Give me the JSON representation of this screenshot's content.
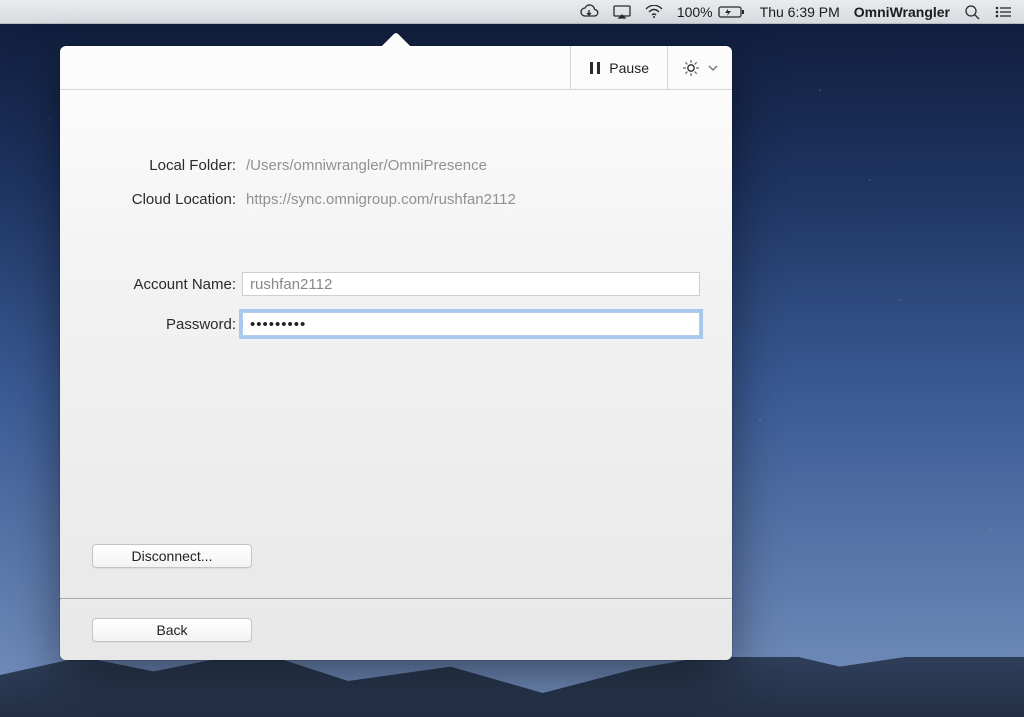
{
  "menubar": {
    "battery_percent": "100%",
    "clock": "Thu 6:39 PM",
    "app_name": "OmniWrangler"
  },
  "popover": {
    "toolbar": {
      "pause_label": "Pause"
    },
    "form": {
      "local_folder_label": "Local Folder:",
      "local_folder_value": "/Users/omniwrangler/OmniPresence",
      "cloud_location_label": "Cloud Location:",
      "cloud_location_value": "https://sync.omnigroup.com/rushfan2112",
      "account_name_label": "Account Name:",
      "account_name_value": "rushfan2112",
      "password_label": "Password:",
      "password_value": "•••••••••"
    },
    "buttons": {
      "disconnect_label": "Disconnect...",
      "back_label": "Back"
    }
  }
}
